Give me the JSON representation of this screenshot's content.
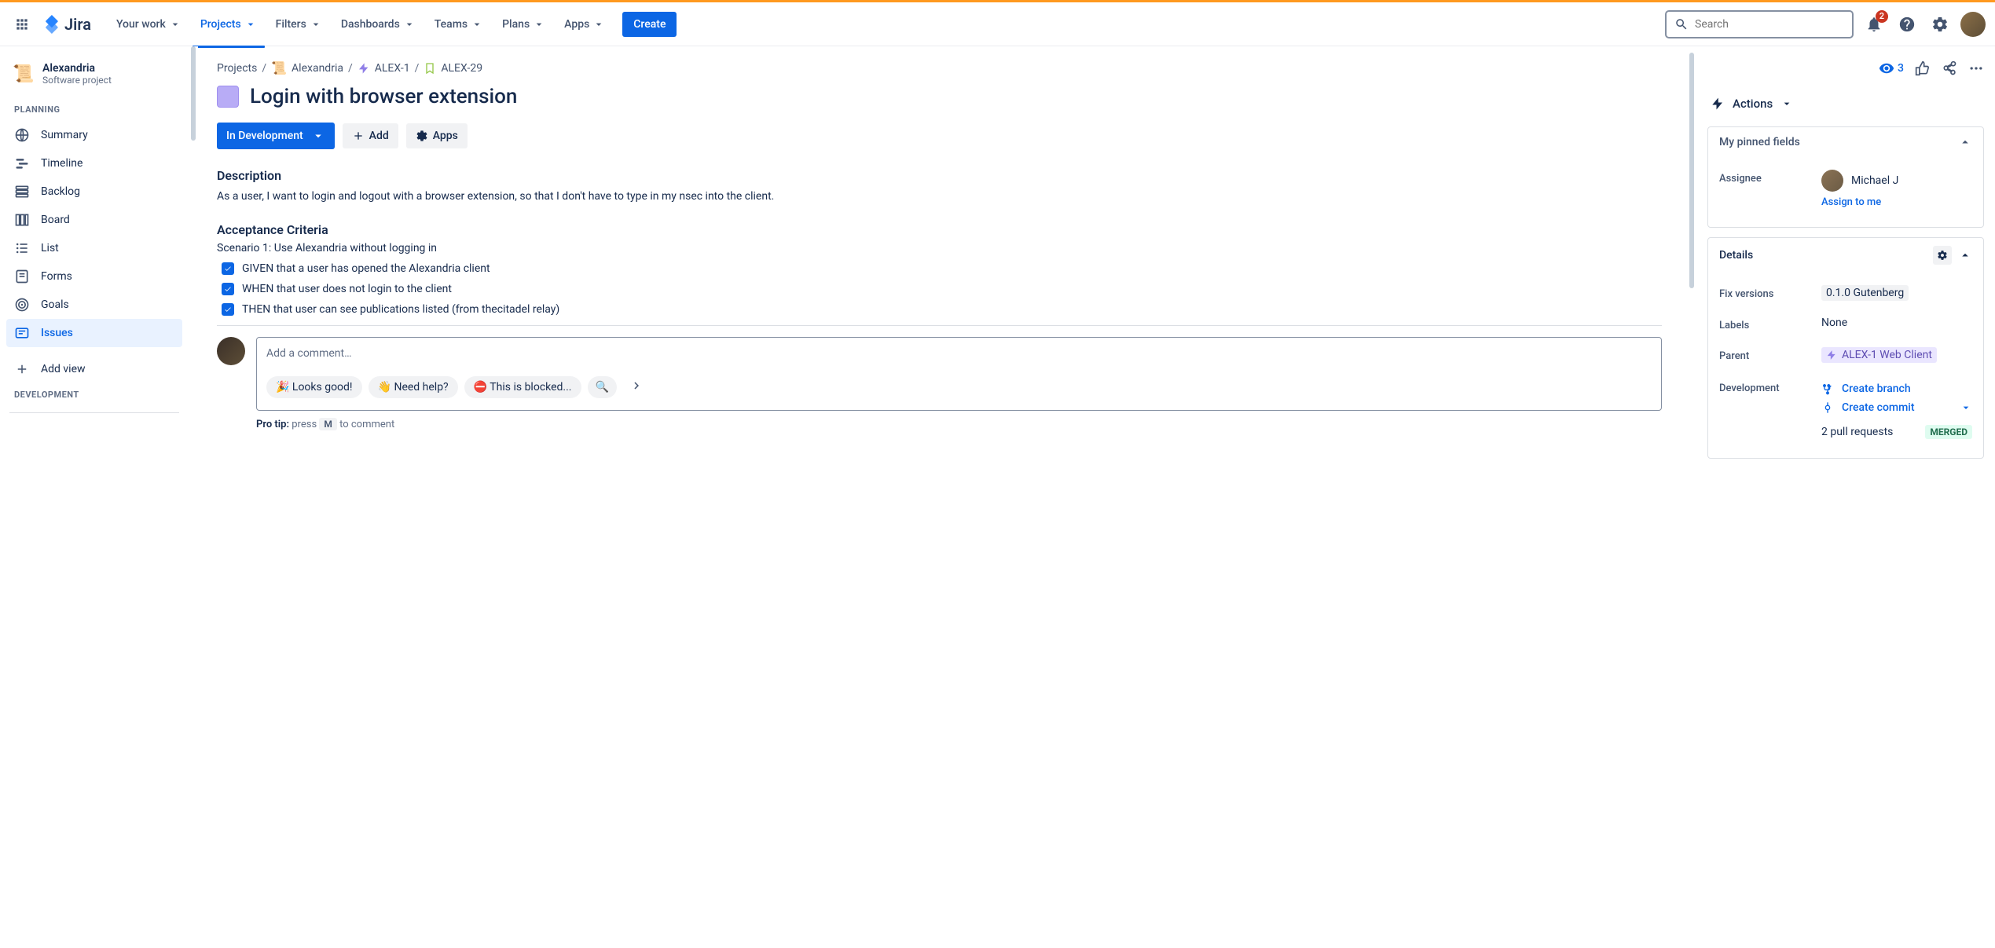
{
  "topnav": {
    "logo_text": "Jira",
    "items": [
      "Your work",
      "Projects",
      "Filters",
      "Dashboards",
      "Teams",
      "Plans",
      "Apps"
    ],
    "active_index": 1,
    "create": "Create",
    "search_placeholder": "Search",
    "notification_count": "2"
  },
  "project": {
    "name": "Alexandria",
    "type": "Software project"
  },
  "sidebar": {
    "section_planning": "PLANNING",
    "section_development": "DEVELOPMENT",
    "items": [
      "Summary",
      "Timeline",
      "Backlog",
      "Board",
      "List",
      "Forms",
      "Goals",
      "Issues"
    ],
    "add_view": "Add view"
  },
  "breadcrumbs": {
    "projects": "Projects",
    "project": "Alexandria",
    "epic": "ALEX-1",
    "issue": "ALEX-29"
  },
  "issue": {
    "title": "Login with browser extension",
    "status": "In Development",
    "add": "Add",
    "apps": "Apps",
    "description_h": "Description",
    "description": "As a user, I want to login and logout with a browser extension, so that I don't have to type in my nsec into the client.",
    "acceptance_h": "Acceptance Criteria",
    "scenario": "Scenario 1: Use Alexandria without logging in",
    "criteria": [
      "GIVEN that a user has opened the Alexandria client",
      "WHEN that user does not login to the client",
      "THEN that user can see publications listed (from thecitadel relay)"
    ]
  },
  "comment": {
    "placeholder": "Add a comment…",
    "chips": [
      "🎉 Looks good!",
      "👋 Need help?",
      "⛔ This is blocked...",
      "🔍"
    ],
    "protip_bold": "Pro tip:",
    "protip_pre": " press ",
    "protip_key": "M",
    "protip_post": " to comment"
  },
  "right": {
    "watch_count": "3",
    "actions": "Actions",
    "pinned_h": "My pinned fields",
    "assignee_label": "Assignee",
    "assignee_name": "Michael J",
    "assign_to_me": "Assign to me",
    "details_h": "Details",
    "fix_versions_label": "Fix versions",
    "fix_versions_value": "0.1.0 Gutenberg",
    "labels_label": "Labels",
    "labels_value": "None",
    "parent_label": "Parent",
    "parent_value": "ALEX-1 Web Client",
    "development_label": "Development",
    "create_branch": "Create branch",
    "create_commit": "Create commit",
    "pull_requests": "2 pull requests",
    "merged": "MERGED"
  }
}
